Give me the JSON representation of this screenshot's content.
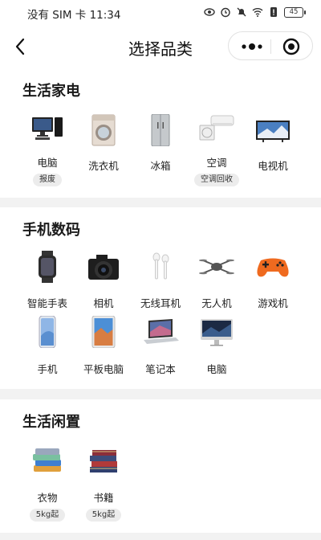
{
  "status_bar": {
    "carrier_time": "没有 SIM 卡 11:34",
    "battery": "45"
  },
  "navbar": {
    "title": "选择品类",
    "back_icon": "chevron-left-icon",
    "more_icon": "more-dots-icon",
    "close_icon": "target-circle-icon"
  },
  "sections": [
    {
      "title": "生活家电",
      "items": [
        {
          "label": "电脑",
          "tag": "报废",
          "icon": "desktop-computer-icon"
        },
        {
          "label": "洗衣机",
          "icon": "washing-machine-icon"
        },
        {
          "label": "冰箱",
          "icon": "refrigerator-icon"
        },
        {
          "label": "空调",
          "tag": "空调回收",
          "icon": "air-conditioner-icon"
        },
        {
          "label": "电视机",
          "icon": "television-icon"
        }
      ]
    },
    {
      "title": "手机数码",
      "items": [
        {
          "label": "智能手表",
          "icon": "smartwatch-icon"
        },
        {
          "label": "相机",
          "icon": "camera-icon"
        },
        {
          "label": "无线耳机",
          "icon": "wireless-earbuds-icon"
        },
        {
          "label": "无人机",
          "icon": "drone-icon"
        },
        {
          "label": "游戏机",
          "icon": "gamepad-icon"
        },
        {
          "label": "手机",
          "icon": "smartphone-icon"
        },
        {
          "label": "平板电脑",
          "icon": "tablet-icon"
        },
        {
          "label": "笔记本",
          "icon": "laptop-icon"
        },
        {
          "label": "电脑",
          "icon": "imac-icon"
        }
      ]
    },
    {
      "title": "生活闲置",
      "items": [
        {
          "label": "衣物",
          "tag": "5kg起",
          "icon": "folded-clothes-icon"
        },
        {
          "label": "书籍",
          "tag": "5kg起",
          "icon": "books-icon"
        }
      ]
    }
  ]
}
